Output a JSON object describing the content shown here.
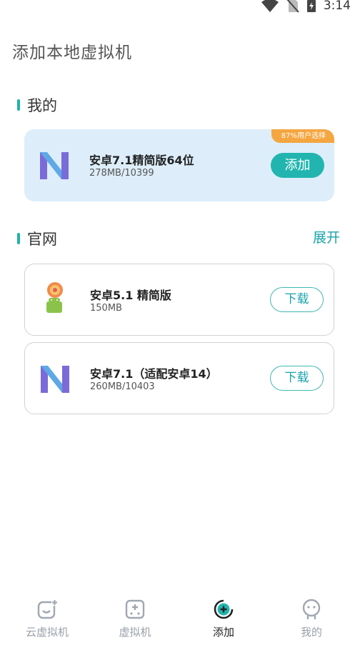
{
  "status_bar": {
    "time": "3:14"
  },
  "page": {
    "title": "添加本地虚拟机"
  },
  "mine_section": {
    "title": "我的",
    "card": {
      "name": "安卓7.1精简版64位",
      "sub": "278MB/10399",
      "ribbon": "87%用户选择",
      "button": "添加",
      "icon": "android-nougat-icon"
    }
  },
  "official_section": {
    "title": "官网",
    "expand": "展开",
    "items": [
      {
        "name": "安卓5.1 精简版",
        "sub": "150MB",
        "button": "下载",
        "icon": "android-lollipop-icon"
      },
      {
        "name": "安卓7.1（适配安卓14）",
        "sub": "260MB/10403",
        "button": "下载",
        "icon": "android-nougat-icon"
      }
    ]
  },
  "tabbar": {
    "tabs": [
      {
        "label": "云虚拟机",
        "icon": "cloud-vm-icon",
        "active": false
      },
      {
        "label": "虚拟机",
        "icon": "vm-icon",
        "active": false
      },
      {
        "label": "添加",
        "icon": "add-icon",
        "active": true
      },
      {
        "label": "我的",
        "icon": "profile-icon",
        "active": false
      }
    ]
  },
  "colors": {
    "accent": "#22b5b0",
    "ribbon": "#f4a640",
    "card_highlight": "#ddeefa"
  }
}
